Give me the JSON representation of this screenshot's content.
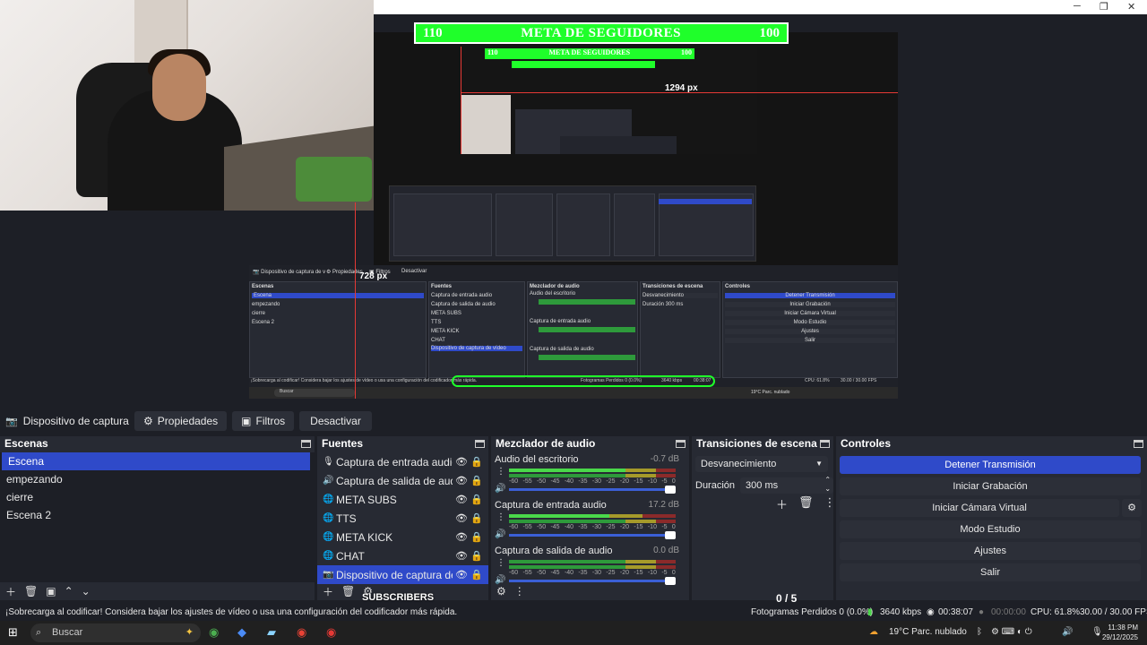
{
  "preview": {
    "meta_goal": {
      "left": "110",
      "title": "META DE SEGUIDORES",
      "right": "100"
    },
    "nested_meta": {
      "left": "110",
      "title": "META DE SEGUIDORES",
      "right": "100"
    },
    "px_width_label": "1294 px",
    "px_height_label": "728 px",
    "nested_status": "¡Sobrecarga al codificar! Considera bajar los ajustes de vídeo o usa una configuración del codificador más rápida.",
    "nested_frames": "Fotogramas Perdidos 0 (0.0%)",
    "nested_kbps": "3640 kbps",
    "nested_time": "00:38:07",
    "nested_cpu": "CPU: 61.8%",
    "nested_fps": "30.00 / 30.00 FPS",
    "nested_weather": "19°C Parc. nublado",
    "nested_search": "Buscar"
  },
  "source_toolbar": {
    "source_name": "Dispositivo de captura de v",
    "properties_label": "Propiedades",
    "filters_label": "Filtros",
    "deactivate_label": "Desactivar"
  },
  "scenes": {
    "title": "Escenas",
    "items": [
      "Escena",
      "empezando",
      "cierre",
      "Escena 2"
    ]
  },
  "sources": {
    "title": "Fuentes",
    "items": [
      {
        "label": "Captura de entrada audio",
        "icon": "mic-icon"
      },
      {
        "label": "Captura de salida de audio",
        "icon": "speaker-icon"
      },
      {
        "label": "META SUBS",
        "icon": "globe-icon"
      },
      {
        "label": "TTS",
        "icon": "globe-icon"
      },
      {
        "label": "META KICK",
        "icon": "globe-icon"
      },
      {
        "label": "CHAT",
        "icon": "globe-icon"
      },
      {
        "label": "Dispositivo de captura de vídeo",
        "icon": "camera-icon"
      }
    ]
  },
  "mixer": {
    "title": "Mezclador de audio",
    "channels": [
      {
        "name": "Audio del escritorio",
        "db": "-0.7 dB",
        "level": 0.88
      },
      {
        "name": "Captura de entrada audio",
        "db": "17.2 dB",
        "level": 0.82
      },
      {
        "name": "Captura de salida de audio",
        "db": "0.0 dB",
        "level": 0.91
      }
    ],
    "scale": [
      "-60",
      "-55",
      "-50",
      "-45",
      "-40",
      "-35",
      "-30",
      "-25",
      "-20",
      "-15",
      "-10",
      "-5",
      "0"
    ]
  },
  "transitions": {
    "title": "Transiciones de escena",
    "selected": "Desvanecimiento",
    "duration_label": "Duración",
    "duration_value": "300 ms"
  },
  "controls": {
    "title": "Controles",
    "stop_stream": "Detener Transmisión",
    "start_recording": "Iniciar Grabación",
    "start_virtual_cam": "Iniciar Cámara Virtual",
    "studio_mode": "Modo Estudio",
    "settings": "Ajustes",
    "exit": "Salir"
  },
  "overlay": {
    "subscribers": "SUBSCRIBERS",
    "counter": "0 / 5"
  },
  "status": {
    "warning": "¡Sobrecarga al codificar! Considera bajar los ajustes de vídeo o usa una configuración del codificador más rápida.",
    "frames": "Fotogramas Perdidos 0 (0.0%)",
    "kbps": "3640 kbps",
    "stream_time": "00:38:07",
    "rec_time": "00:00:00",
    "cpu": "CPU: 61.8%",
    "fps": "30.00 / 30.00 FPS"
  },
  "taskbar": {
    "search": "Buscar",
    "weather": "19°C  Parc. nublado",
    "time": "11:38 PM",
    "date": "29/12/2025"
  }
}
